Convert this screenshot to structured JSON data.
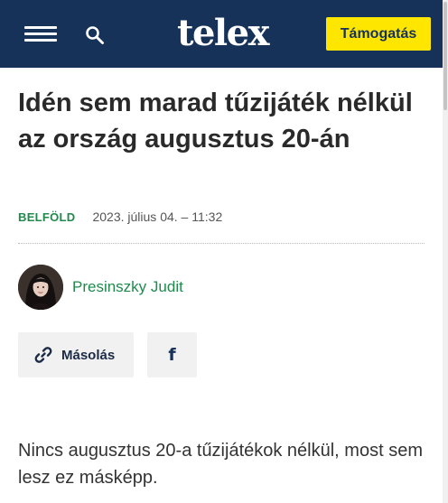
{
  "header": {
    "logo": "telex",
    "support_label": "Támogatás",
    "menu_icon": "hamburger-menu-icon",
    "search_icon": "search-icon",
    "background_color": "#163259",
    "support_color": "#ffe600"
  },
  "article": {
    "title": "Idén sem marad tűzijáték nélkül az ország augusztus 20-án",
    "category": "BELFÖLD",
    "date": "2023. július 04. – 11:32",
    "author": "Presinszky Judit",
    "lead": "Nincs augusztus 20-a tűzijátékok nélkül, most sem lesz ez másképp.",
    "accent_color": "#1f8a4c"
  },
  "share": {
    "copy_label": "Másolás",
    "copy_icon": "link-icon",
    "facebook_glyph": "f",
    "facebook_icon": "facebook-icon"
  }
}
